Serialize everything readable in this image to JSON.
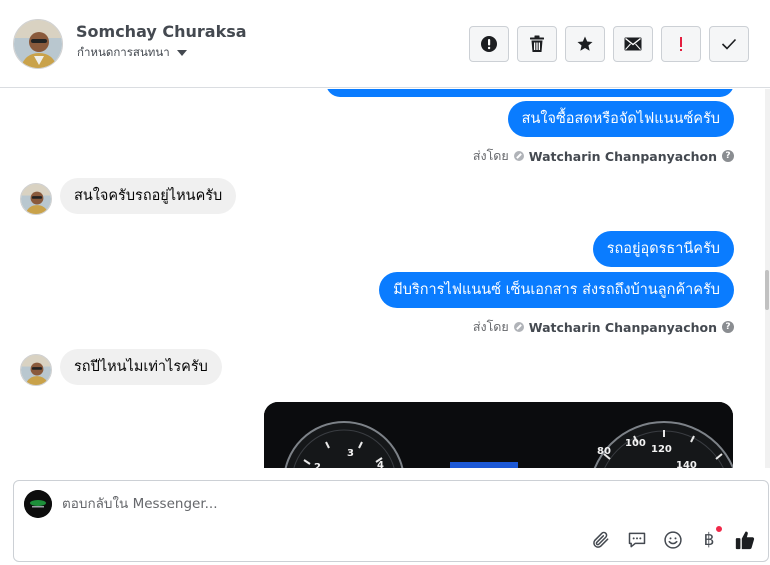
{
  "header": {
    "contact_name": "Somchay Churaksa",
    "contact_subtitle": "กำหนดการสนทนา",
    "toolbar": [
      {
        "name": "report-spam-button",
        "icon": "exclamation-circle-icon"
      },
      {
        "name": "delete-button",
        "icon": "trash-icon"
      },
      {
        "name": "star-button",
        "icon": "star-icon"
      },
      {
        "name": "mark-unread-button",
        "icon": "envelope-icon"
      },
      {
        "name": "mark-important-button",
        "icon": "exclamation-icon"
      },
      {
        "name": "mark-done-button",
        "icon": "check-icon"
      }
    ]
  },
  "conversation": {
    "messages": [
      {
        "direction": "out",
        "text": "สนใจซื้อสดหรือจัดไฟแนนซ์ครับ"
      },
      {
        "direction": "meta",
        "prefix": "ส่งโดย",
        "sender": "Watcharin Chanpanyachon"
      },
      {
        "direction": "in",
        "text": "สนใจครับรถอยู่ไหนครับ"
      },
      {
        "direction": "out",
        "text": "รถอยู่อุดรธานีครับ"
      },
      {
        "direction": "out",
        "text": "มีบริการไฟแนนซ์ เซ็นเอกสาร ส่งรถถึงบ้านลูกค้าครับ"
      },
      {
        "direction": "meta",
        "prefix": "ส่งโดย",
        "sender": "Watcharin Chanpanyachon"
      },
      {
        "direction": "in",
        "text": "รถปีไหนไมเท่าไรครับ"
      }
    ],
    "photo": {
      "icon": "car-dashboard-photo",
      "gauge_labels": [
        "2",
        "3",
        "4",
        "80",
        "100",
        "120",
        "140"
      ]
    }
  },
  "composer": {
    "placeholder": "ตอบกลับใน Messenger...",
    "icons": [
      "paperclip-icon",
      "quick-reply-icon",
      "emoji-icon",
      "baht-payment-icon",
      "like-icon"
    ],
    "baht_symbol": "฿"
  },
  "colors": {
    "accent": "#0a7cff",
    "incoming": "#f0f0f0",
    "alert": "#f02849"
  }
}
